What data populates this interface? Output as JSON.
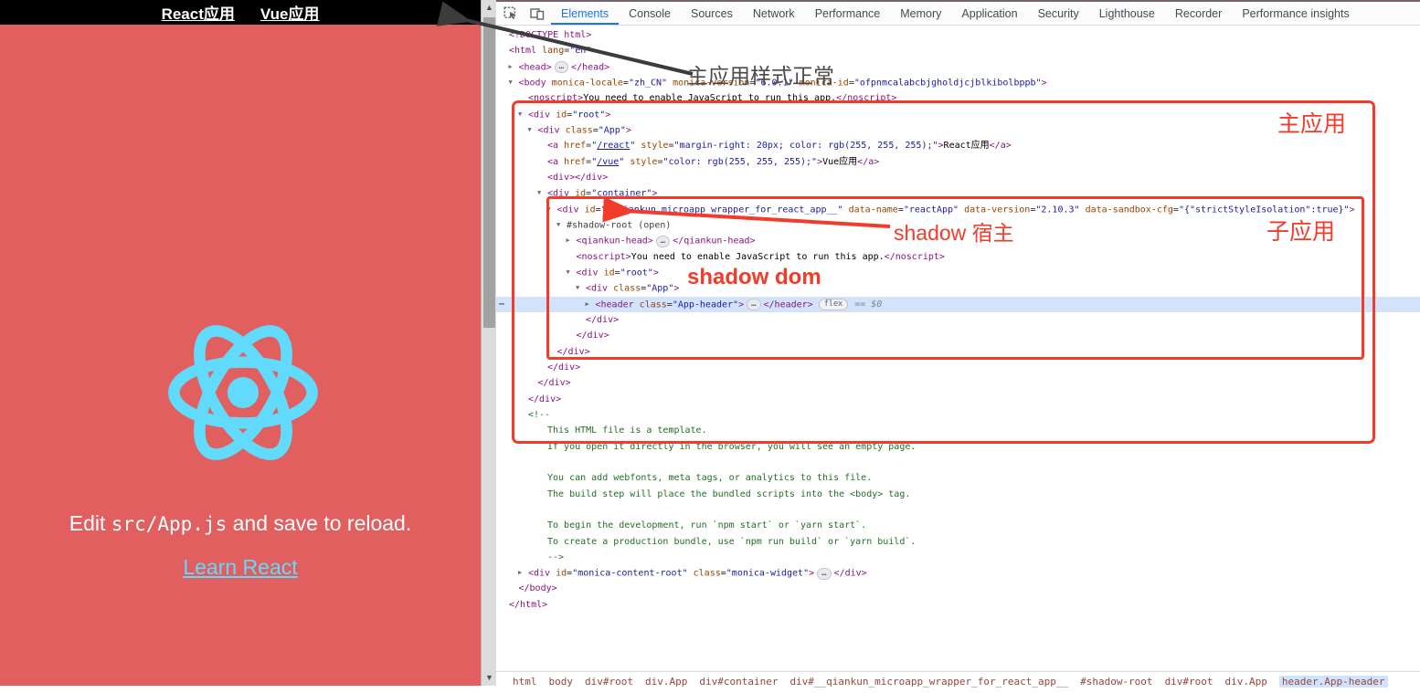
{
  "app": {
    "nav_links": [
      {
        "label": "React应用"
      },
      {
        "label": "Vue应用"
      }
    ],
    "edit_text": {
      "before": "Edit ",
      "code": "src/App.js",
      "after": " and save to reload."
    },
    "learn_link": "Learn React",
    "colors": {
      "background": "#e25f5f",
      "nav_background": "#000000",
      "logo": "#61dafb",
      "link": "#61dafb"
    }
  },
  "devtools": {
    "tabs": [
      {
        "label": "Elements",
        "active": true
      },
      {
        "label": "Console",
        "active": false
      },
      {
        "label": "Sources",
        "active": false
      },
      {
        "label": "Network",
        "active": false
      },
      {
        "label": "Performance",
        "active": false
      },
      {
        "label": "Memory",
        "active": false
      },
      {
        "label": "Application",
        "active": false
      },
      {
        "label": "Security",
        "active": false
      },
      {
        "label": "Lighthouse",
        "active": false
      },
      {
        "label": "Recorder",
        "active": false
      },
      {
        "label": "Performance insights",
        "active": false
      }
    ],
    "tree": {
      "lines": [
        {
          "indent": 0,
          "arrow": null,
          "parts": [
            [
              "tag",
              "<!DOCTYPE html>"
            ]
          ]
        },
        {
          "indent": 0,
          "arrow": null,
          "parts": [
            [
              "tag",
              "<html"
            ],
            [
              "attr",
              " lang"
            ],
            [
              "eq",
              "="
            ],
            [
              "val",
              "\"en\""
            ],
            [
              "tag",
              ">"
            ]
          ]
        },
        {
          "indent": 1,
          "arrow": "closed",
          "parts": [
            [
              "tag",
              "<head>"
            ],
            [
              "dots",
              "…"
            ],
            [
              "tag",
              "</head>"
            ]
          ]
        },
        {
          "indent": 1,
          "arrow": "open",
          "parts": [
            [
              "tag",
              "<body"
            ],
            [
              "attr",
              " monica-locale"
            ],
            [
              "eq",
              "="
            ],
            [
              "val",
              "\"zh_CN\""
            ],
            [
              "attr",
              " monica-version"
            ],
            [
              "eq",
              "="
            ],
            [
              "val",
              "\"6.0.1\""
            ],
            [
              "attr",
              " monica-id"
            ],
            [
              "eq",
              "="
            ],
            [
              "val",
              "\"ofpnmcalabcbjgholdjcjblkibolbppb\""
            ],
            [
              "tag",
              ">"
            ]
          ]
        },
        {
          "indent": 2,
          "arrow": null,
          "parts": [
            [
              "tag",
              "<noscript>"
            ],
            [
              "text",
              "You need to enable JavaScript to run this app."
            ],
            [
              "tag",
              "</noscript>"
            ]
          ]
        },
        {
          "indent": 2,
          "arrow": "open",
          "parts": [
            [
              "tag",
              "<div"
            ],
            [
              "attr",
              " id"
            ],
            [
              "eq",
              "="
            ],
            [
              "val",
              "\"root\""
            ],
            [
              "tag",
              ">"
            ]
          ]
        },
        {
          "indent": 3,
          "arrow": "open",
          "parts": [
            [
              "tag",
              "<div"
            ],
            [
              "attr",
              " class"
            ],
            [
              "eq",
              "="
            ],
            [
              "val",
              "\"App\""
            ],
            [
              "tag",
              ">"
            ]
          ]
        },
        {
          "indent": 4,
          "arrow": null,
          "parts": [
            [
              "tag",
              "<a"
            ],
            [
              "attr",
              " href"
            ],
            [
              "eq",
              "="
            ],
            [
              "val",
              "\""
            ],
            [
              "link",
              "/react"
            ],
            [
              "val",
              "\""
            ],
            [
              "attr",
              " style"
            ],
            [
              "eq",
              "="
            ],
            [
              "val",
              "\"margin-right: 20px; color: rgb(255, 255, 255);\""
            ],
            [
              "tag",
              ">"
            ],
            [
              "text",
              "React应用"
            ],
            [
              "tag",
              "</a>"
            ]
          ]
        },
        {
          "indent": 4,
          "arrow": null,
          "parts": [
            [
              "tag",
              "<a"
            ],
            [
              "attr",
              " href"
            ],
            [
              "eq",
              "="
            ],
            [
              "val",
              "\""
            ],
            [
              "link",
              "/vue"
            ],
            [
              "val",
              "\""
            ],
            [
              "attr",
              " style"
            ],
            [
              "eq",
              "="
            ],
            [
              "val",
              "\"color: rgb(255, 255, 255);\""
            ],
            [
              "tag",
              ">"
            ],
            [
              "text",
              "Vue应用"
            ],
            [
              "tag",
              "</a>"
            ]
          ]
        },
        {
          "indent": 4,
          "arrow": null,
          "parts": [
            [
              "tag",
              "<div></div>"
            ]
          ]
        },
        {
          "indent": 4,
          "arrow": "open",
          "parts": [
            [
              "tag",
              "<div"
            ],
            [
              "attr",
              " id"
            ],
            [
              "eq",
              "="
            ],
            [
              "val",
              "\"container\""
            ],
            [
              "tag",
              ">"
            ]
          ]
        },
        {
          "indent": 5,
          "arrow": "open",
          "parts": [
            [
              "tag",
              "<div"
            ],
            [
              "attr",
              " id"
            ],
            [
              "eq",
              "="
            ],
            [
              "val",
              "\"__qiankun_microapp_wrapper_for_react_app__\""
            ],
            [
              "attr",
              " data-name"
            ],
            [
              "eq",
              "="
            ],
            [
              "val",
              "\"reactApp\""
            ],
            [
              "attr",
              " data-version"
            ],
            [
              "eq",
              "="
            ],
            [
              "val",
              "\"2.10.3\""
            ],
            [
              "attr",
              " data-sandbox-cfg"
            ],
            [
              "eq",
              "="
            ],
            [
              "val",
              "\"{\"strictStyleIsolation\":true}\""
            ],
            [
              "tag",
              ">"
            ]
          ]
        },
        {
          "indent": 6,
          "arrow": "open",
          "parts": [
            [
              "shadow",
              "#shadow-root (open)"
            ]
          ]
        },
        {
          "indent": 7,
          "arrow": "closed",
          "parts": [
            [
              "tag",
              "<qiankun-head>"
            ],
            [
              "dots",
              "…"
            ],
            [
              "tag",
              "</qiankun-head>"
            ]
          ]
        },
        {
          "indent": 7,
          "arrow": null,
          "parts": [
            [
              "tag",
              "<noscript>"
            ],
            [
              "text",
              "You need to enable JavaScript to run this app."
            ],
            [
              "tag",
              "</noscript>"
            ]
          ]
        },
        {
          "indent": 7,
          "arrow": "open",
          "parts": [
            [
              "tag",
              "<div"
            ],
            [
              "attr",
              " id"
            ],
            [
              "eq",
              "="
            ],
            [
              "val",
              "\"root\""
            ],
            [
              "tag",
              ">"
            ]
          ]
        },
        {
          "indent": 8,
          "arrow": "open",
          "parts": [
            [
              "tag",
              "<div"
            ],
            [
              "attr",
              " class"
            ],
            [
              "eq",
              "="
            ],
            [
              "val",
              "\"App\""
            ],
            [
              "tag",
              ">"
            ]
          ]
        },
        {
          "indent": 9,
          "arrow": "closed",
          "selected": true,
          "parts": [
            [
              "tag",
              "<header"
            ],
            [
              "attr",
              " class"
            ],
            [
              "eq",
              "="
            ],
            [
              "val",
              "\"App-header\""
            ],
            [
              "tag",
              ">"
            ],
            [
              "dots",
              "…"
            ],
            [
              "tag",
              "</header>"
            ],
            [
              "badge",
              "flex"
            ],
            [
              "dollar",
              "== $0"
            ]
          ]
        },
        {
          "indent": 8,
          "arrow": null,
          "parts": [
            [
              "tag",
              "</div>"
            ]
          ]
        },
        {
          "indent": 7,
          "arrow": null,
          "parts": [
            [
              "tag",
              "</div>"
            ]
          ]
        },
        {
          "indent": 5,
          "arrow": null,
          "parts": [
            [
              "tag",
              "</div>"
            ]
          ]
        },
        {
          "indent": 4,
          "arrow": null,
          "parts": [
            [
              "tag",
              "</div>"
            ]
          ]
        },
        {
          "indent": 3,
          "arrow": null,
          "parts": [
            [
              "tag",
              "</div>"
            ]
          ]
        },
        {
          "indent": 2,
          "arrow": null,
          "parts": [
            [
              "tag",
              "</div>"
            ]
          ]
        },
        {
          "indent": 2,
          "arrow": null,
          "parts": [
            [
              "comment",
              "<!--"
            ]
          ]
        },
        {
          "indent": 4,
          "arrow": null,
          "parts": [
            [
              "comment",
              "This HTML file is a template."
            ]
          ]
        },
        {
          "indent": 4,
          "arrow": null,
          "parts": [
            [
              "comment",
              "If you open it directly in the browser, you will see an empty page."
            ]
          ]
        },
        {
          "indent": 4,
          "arrow": null,
          "parts": []
        },
        {
          "indent": 4,
          "arrow": null,
          "parts": [
            [
              "comment",
              "You can add webfonts, meta tags, or analytics to this file."
            ]
          ]
        },
        {
          "indent": 4,
          "arrow": null,
          "parts": [
            [
              "comment",
              "The build step will place the bundled scripts into the <body> tag."
            ]
          ]
        },
        {
          "indent": 4,
          "arrow": null,
          "parts": []
        },
        {
          "indent": 4,
          "arrow": null,
          "parts": [
            [
              "comment",
              "To begin the development, run `npm start` or `yarn start`."
            ]
          ]
        },
        {
          "indent": 4,
          "arrow": null,
          "parts": [
            [
              "comment",
              "To create a production bundle, use `npm run build` or `yarn build`."
            ]
          ]
        },
        {
          "indent": 4,
          "arrow": null,
          "parts": [
            [
              "comment",
              "-->"
            ]
          ]
        },
        {
          "indent": 2,
          "arrow": "closed",
          "parts": [
            [
              "tag",
              "<div"
            ],
            [
              "attr",
              " id"
            ],
            [
              "eq",
              "="
            ],
            [
              "val",
              "\"monica-content-root\""
            ],
            [
              "attr",
              " class"
            ],
            [
              "eq",
              "="
            ],
            [
              "val",
              "\"monica-widget\""
            ],
            [
              "tag",
              ">"
            ],
            [
              "dots",
              "…"
            ],
            [
              "tag",
              "</div>"
            ]
          ]
        },
        {
          "indent": 1,
          "arrow": null,
          "parts": [
            [
              "tag",
              "</body>"
            ]
          ]
        },
        {
          "indent": 0,
          "arrow": null,
          "parts": [
            [
              "tag",
              "</html>"
            ]
          ]
        }
      ]
    },
    "breadcrumbs": [
      {
        "label": "html",
        "selected": false
      },
      {
        "label": "body",
        "selected": false
      },
      {
        "label": "div#root",
        "selected": false
      },
      {
        "label": "div.App",
        "selected": false
      },
      {
        "label": "div#container",
        "selected": false
      },
      {
        "label": "div#__qiankun_microapp_wrapper_for_react_app__",
        "selected": false
      },
      {
        "label": "#shadow-root",
        "selected": false
      },
      {
        "label": "div#root",
        "selected": false
      },
      {
        "label": "div.App",
        "selected": false
      },
      {
        "label": "header.App-header",
        "selected": true
      }
    ]
  },
  "annotations": {
    "main_style_ok": "主应用样式正常",
    "main_app": "主应用",
    "sub_app": "子应用",
    "shadow_host": "shadow 宿主",
    "shadow_dom": "shadow dom",
    "red_color": "#f23b2a"
  }
}
